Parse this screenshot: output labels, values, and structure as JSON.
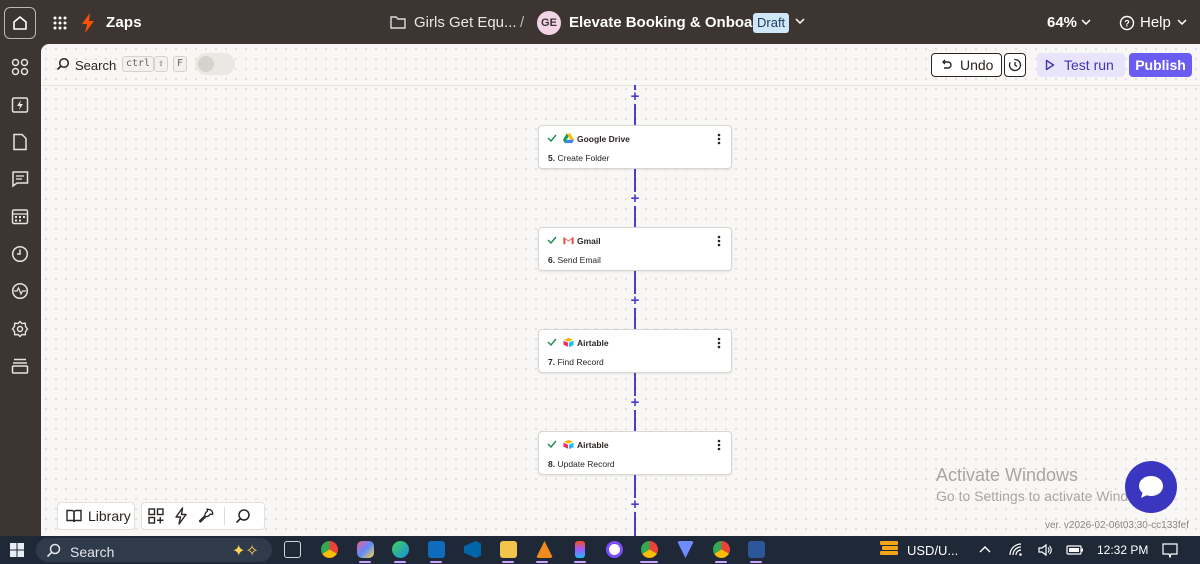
{
  "header": {
    "app_name": "Zaps",
    "folder_name": "Girls Get Equ...",
    "separator": "/",
    "avatar_initials": "GE",
    "zap_name": "Elevate Booking & Onboarding",
    "status_badge": "Draft",
    "zoom": "64%",
    "help": "Help"
  },
  "toolbar": {
    "search_label": "Search",
    "shortcut_keys": [
      "ctrl",
      "⇧",
      "F"
    ],
    "undo_label": "Undo",
    "test_run_label": "Test run",
    "publish_label": "Publish"
  },
  "sidebar": {
    "items": [
      "apps-icon",
      "zaps-icon",
      "tables-icon",
      "interfaces-icon",
      "canvas-icon",
      "history-icon",
      "activity-icon",
      "settings-icon",
      "archive-icon"
    ]
  },
  "steps": [
    {
      "app": "Google Drive",
      "number": "5.",
      "title": "Create Folder",
      "icon": "google-drive-icon"
    },
    {
      "app": "Gmail",
      "number": "6.",
      "title": "Send Email",
      "icon": "gmail-icon"
    },
    {
      "app": "Airtable",
      "number": "7.",
      "title": "Find Record",
      "icon": "airtable-icon"
    },
    {
      "app": "Airtable",
      "number": "8.",
      "title": "Update Record",
      "icon": "airtable-icon"
    }
  ],
  "bottom_tools": {
    "library_label": "Library"
  },
  "watermark": {
    "line1": "Activate Windows",
    "line2": "Go to Settings to activate Windows."
  },
  "version": "ver. v2026-02-06t03:30-cc133fef",
  "taskbar": {
    "search_label": "Search",
    "currency": "USD/U...",
    "time": "12:32 PM"
  },
  "colors": {
    "accent": "#6a5cf0",
    "chrome": "#3d3532",
    "connector": "#4a40c9",
    "taskbar": "#1f2837"
  }
}
